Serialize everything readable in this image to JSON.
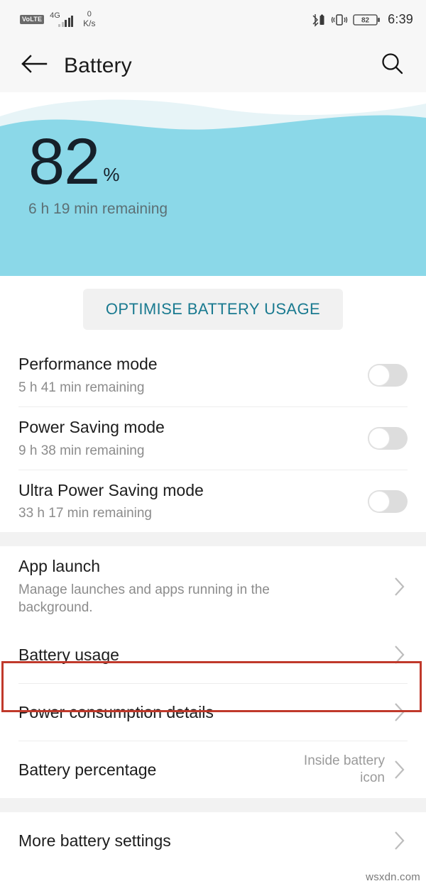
{
  "status_bar": {
    "volte_label": "VoLTE",
    "network_type": "4G",
    "data_rate_value": "0",
    "data_rate_unit": "K/s",
    "bluetooth_icon": "bluetooth-battery-icon",
    "vibrate_icon": "vibrate-icon",
    "battery_level": "82",
    "time": "6:39"
  },
  "app_bar": {
    "back_icon": "back-arrow-icon",
    "title": "Battery",
    "search_icon": "search-icon"
  },
  "hero": {
    "percent": "82",
    "percent_sign": "%",
    "remaining": "6 h 19 min remaining",
    "wave_color": "#8bd8e8",
    "wave_light_color": "#e7f4f7"
  },
  "optimise_button": {
    "label": "OPTIMISE BATTERY USAGE",
    "text_color": "#1a7a90",
    "background": "#f1f1f1"
  },
  "modes": [
    {
      "title": "Performance mode",
      "subtitle": "5 h 41 min remaining",
      "toggle": "off"
    },
    {
      "title": "Power Saving mode",
      "subtitle": "9 h 38 min remaining",
      "toggle": "off"
    },
    {
      "title": "Ultra Power Saving mode",
      "subtitle": "33 h 17 min remaining",
      "toggle": "off"
    }
  ],
  "settings": [
    {
      "title": "App launch",
      "subtitle": "Manage launches and apps running in the background.",
      "value": "",
      "chevron": true
    },
    {
      "title": "Battery usage",
      "subtitle": "",
      "value": "",
      "chevron": true,
      "highlighted": true
    },
    {
      "title": "Power consumption details",
      "subtitle": "",
      "value": "",
      "chevron": true
    },
    {
      "title": "Battery percentage",
      "subtitle": "",
      "value": "Inside battery icon",
      "chevron": true
    }
  ],
  "more": [
    {
      "title": "More battery settings",
      "subtitle": "",
      "value": "",
      "chevron": true
    }
  ],
  "annotation": {
    "color": "#c0392b",
    "target": "Battery usage"
  },
  "watermark": "wsxdn.com"
}
